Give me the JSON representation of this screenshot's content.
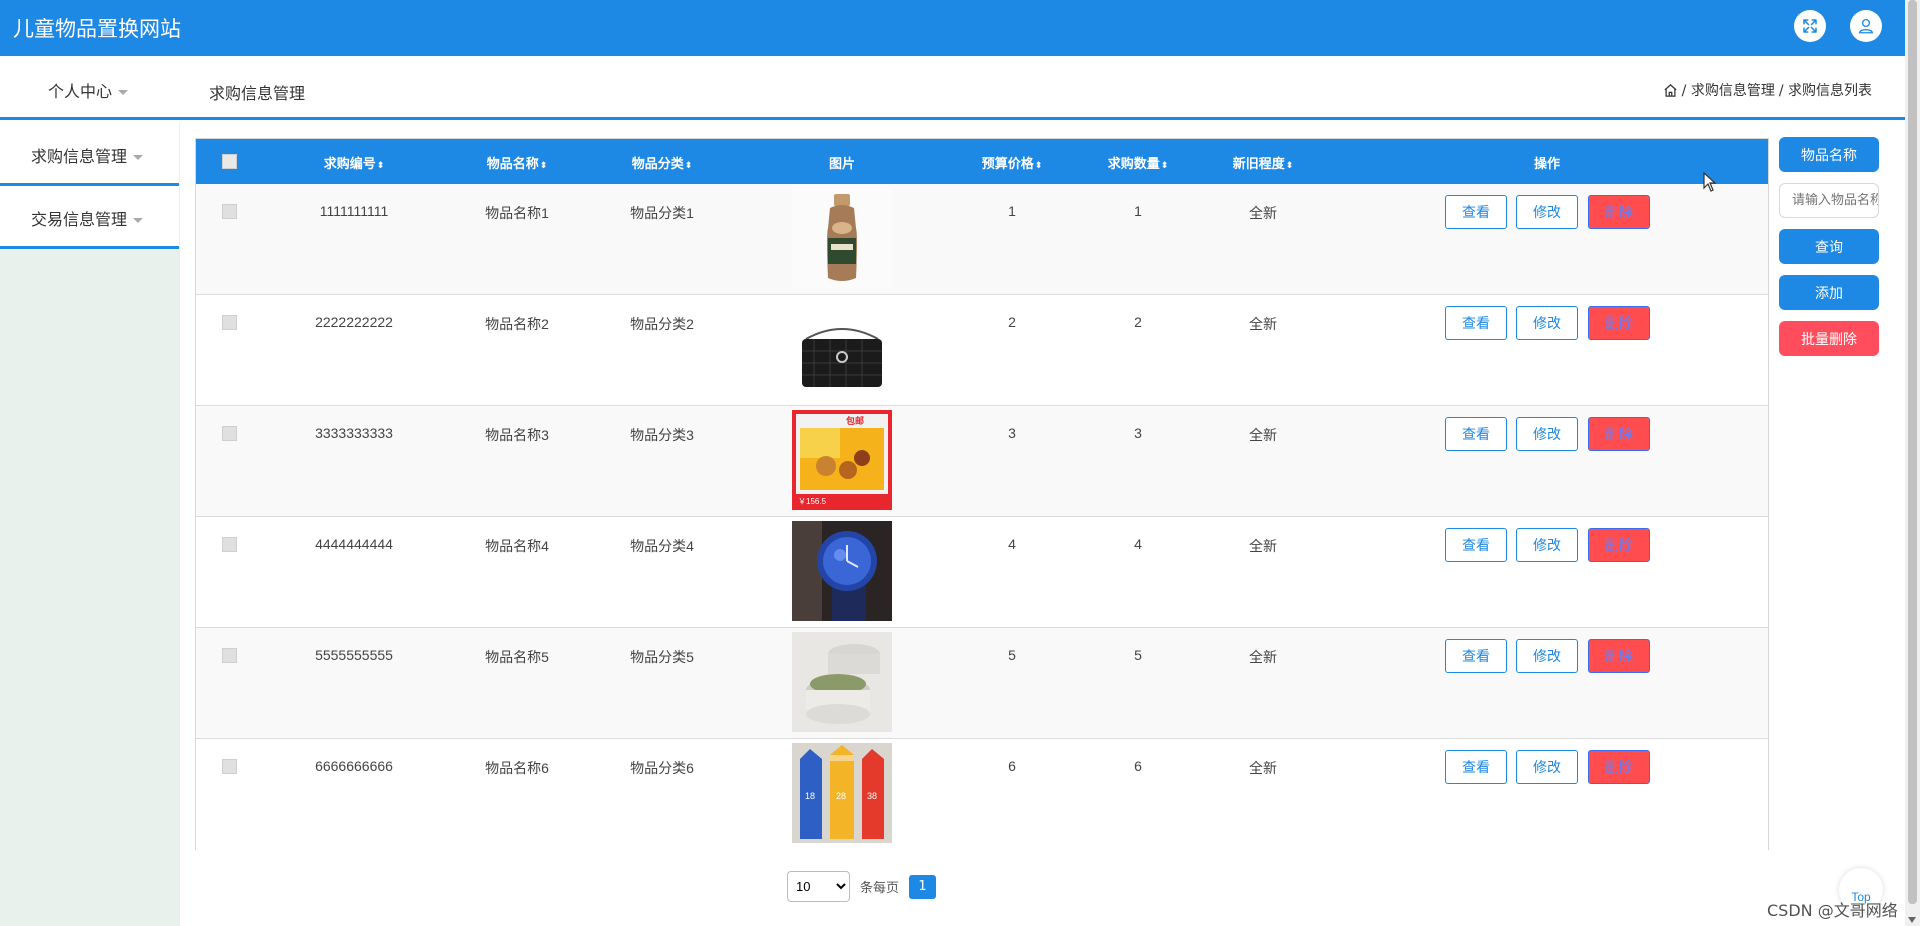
{
  "header": {
    "site_title": "儿童物品置换网站",
    "expand_icon": "expand-icon",
    "user_icon": "user-icon"
  },
  "subbar": {
    "personal_center": "个人中心",
    "page_heading": "求购信息管理",
    "breadcrumb": {
      "home_icon": "home-icon",
      "level1": "/ 求购信息管理",
      "level2": "/ 求购信息列表"
    }
  },
  "sidebar": {
    "items": [
      {
        "label": "求购信息管理"
      },
      {
        "label": "交易信息管理"
      }
    ]
  },
  "table": {
    "headers": {
      "code": "求购编号",
      "name": "物品名称",
      "category": "物品分类",
      "image": "图片",
      "price": "预算价格",
      "qty": "求购数量",
      "condition": "新旧程度",
      "actions": "操作"
    },
    "sort_glyph": "⬍",
    "rows": [
      {
        "code": "1111111111",
        "name": "物品名称1",
        "category": "物品分类1",
        "price": "1",
        "qty": "1",
        "condition": "全新",
        "image": "milk-tea-bottle"
      },
      {
        "code": "2222222222",
        "name": "物品名称2",
        "category": "物品分类2",
        "price": "2",
        "qty": "2",
        "condition": "全新",
        "image": "black-handbag"
      },
      {
        "code": "3333333333",
        "name": "物品名称3",
        "category": "物品分类3",
        "price": "3",
        "qty": "3",
        "condition": "全新",
        "image": "snack-box",
        "image_text": {
          "badge": "包邮",
          "price": "￥156.5"
        }
      },
      {
        "code": "4444444444",
        "name": "物品名称4",
        "category": "物品分类4",
        "price": "4",
        "qty": "4",
        "condition": "全新",
        "image": "blue-watch"
      },
      {
        "code": "5555555555",
        "name": "物品名称5",
        "category": "物品分类5",
        "price": "5",
        "qty": "5",
        "condition": "全新",
        "image": "cream-jars"
      },
      {
        "code": "6666666666",
        "name": "物品名称6",
        "category": "物品分类6",
        "price": "6",
        "qty": "6",
        "condition": "全新",
        "image": "milk-cartons",
        "image_text": {
          "c1": "18",
          "c2": "28",
          "c3": "38"
        }
      }
    ],
    "buttons": {
      "view": "查看",
      "edit": "修改",
      "delete": "删除"
    }
  },
  "right_panel": {
    "field_label": "物品名称",
    "search_placeholder": "请输入物品名称",
    "query": "查询",
    "add": "添加",
    "batch_delete": "批量删除"
  },
  "pagination": {
    "page_size": "10",
    "per_page_label": "条每页",
    "current_page": "1"
  },
  "misc": {
    "top_button": "Top",
    "watermark": "CSDN @文哥网络"
  },
  "colors": {
    "primary": "#1e88e5",
    "danger": "#ff4d4f",
    "sidebar_bg": "#e8f1ec"
  }
}
